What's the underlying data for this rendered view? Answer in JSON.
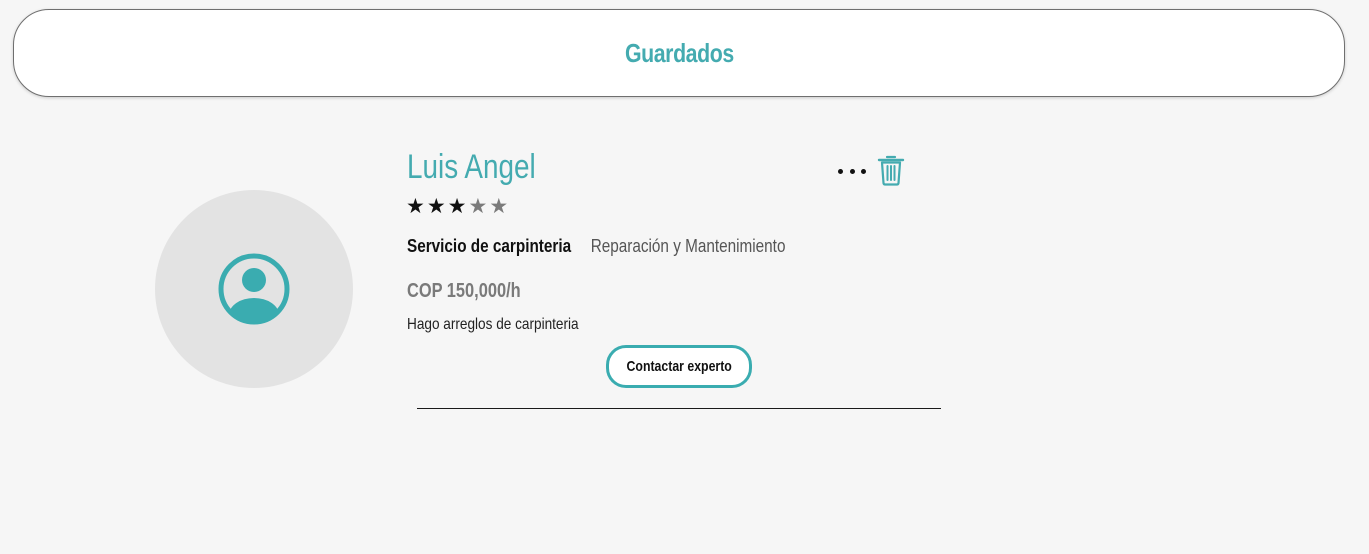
{
  "colors": {
    "accent": "#44abb0",
    "star_filled": "#111111",
    "star_empty": "#7b7b7b",
    "avatar_bg": "#e3e3e3",
    "page_bg": "#f6f6f6"
  },
  "header": {
    "title": "Guardados"
  },
  "saved_items": [
    {
      "avatar_icon": "user-circle-icon",
      "name": "Luis Angel",
      "rating": 3,
      "rating_max": 5,
      "service_name": "Servicio de carpinteria",
      "service_category": "Reparación y Mantenimiento",
      "price": "COP 150,000/h",
      "description": "Hago arreglos de carpinteria",
      "contact_label": "Contactar experto",
      "more_icon": "more-dots-icon",
      "delete_icon": "trash-icon"
    }
  ]
}
